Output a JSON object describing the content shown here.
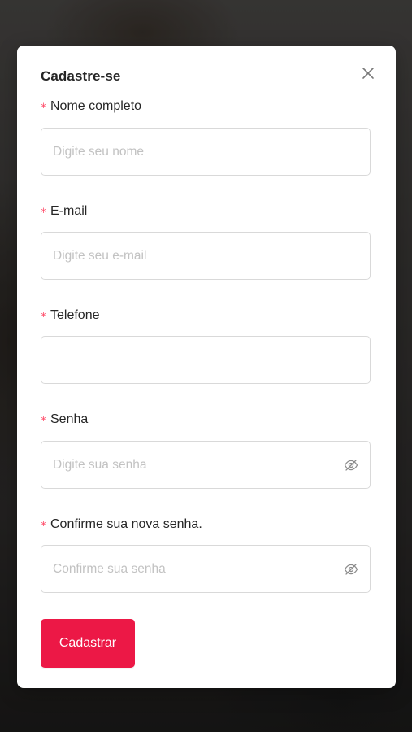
{
  "modal": {
    "title": "Cadastre-se",
    "close_icon": "close-icon"
  },
  "form": {
    "required_marker": "*",
    "fields": [
      {
        "label": "Nome completo",
        "placeholder": "Digite seu nome",
        "value": ""
      },
      {
        "label": "E-mail",
        "placeholder": "Digite seu e-mail",
        "value": ""
      },
      {
        "label": "Telefone",
        "placeholder": "",
        "value": ""
      },
      {
        "label": "Senha",
        "placeholder": "Digite sua senha",
        "value": "",
        "icon": "eye-slash-icon"
      },
      {
        "label": "Confirme sua nova senha.",
        "placeholder": "Confirme sua senha",
        "value": "",
        "icon": "eye-slash-icon"
      }
    ],
    "submit_label": "Cadastrar"
  },
  "colors": {
    "accent": "#ec1846",
    "required": "#ff4d6a",
    "border": "#d9d9d9",
    "placeholder": "#c2c2c2"
  }
}
